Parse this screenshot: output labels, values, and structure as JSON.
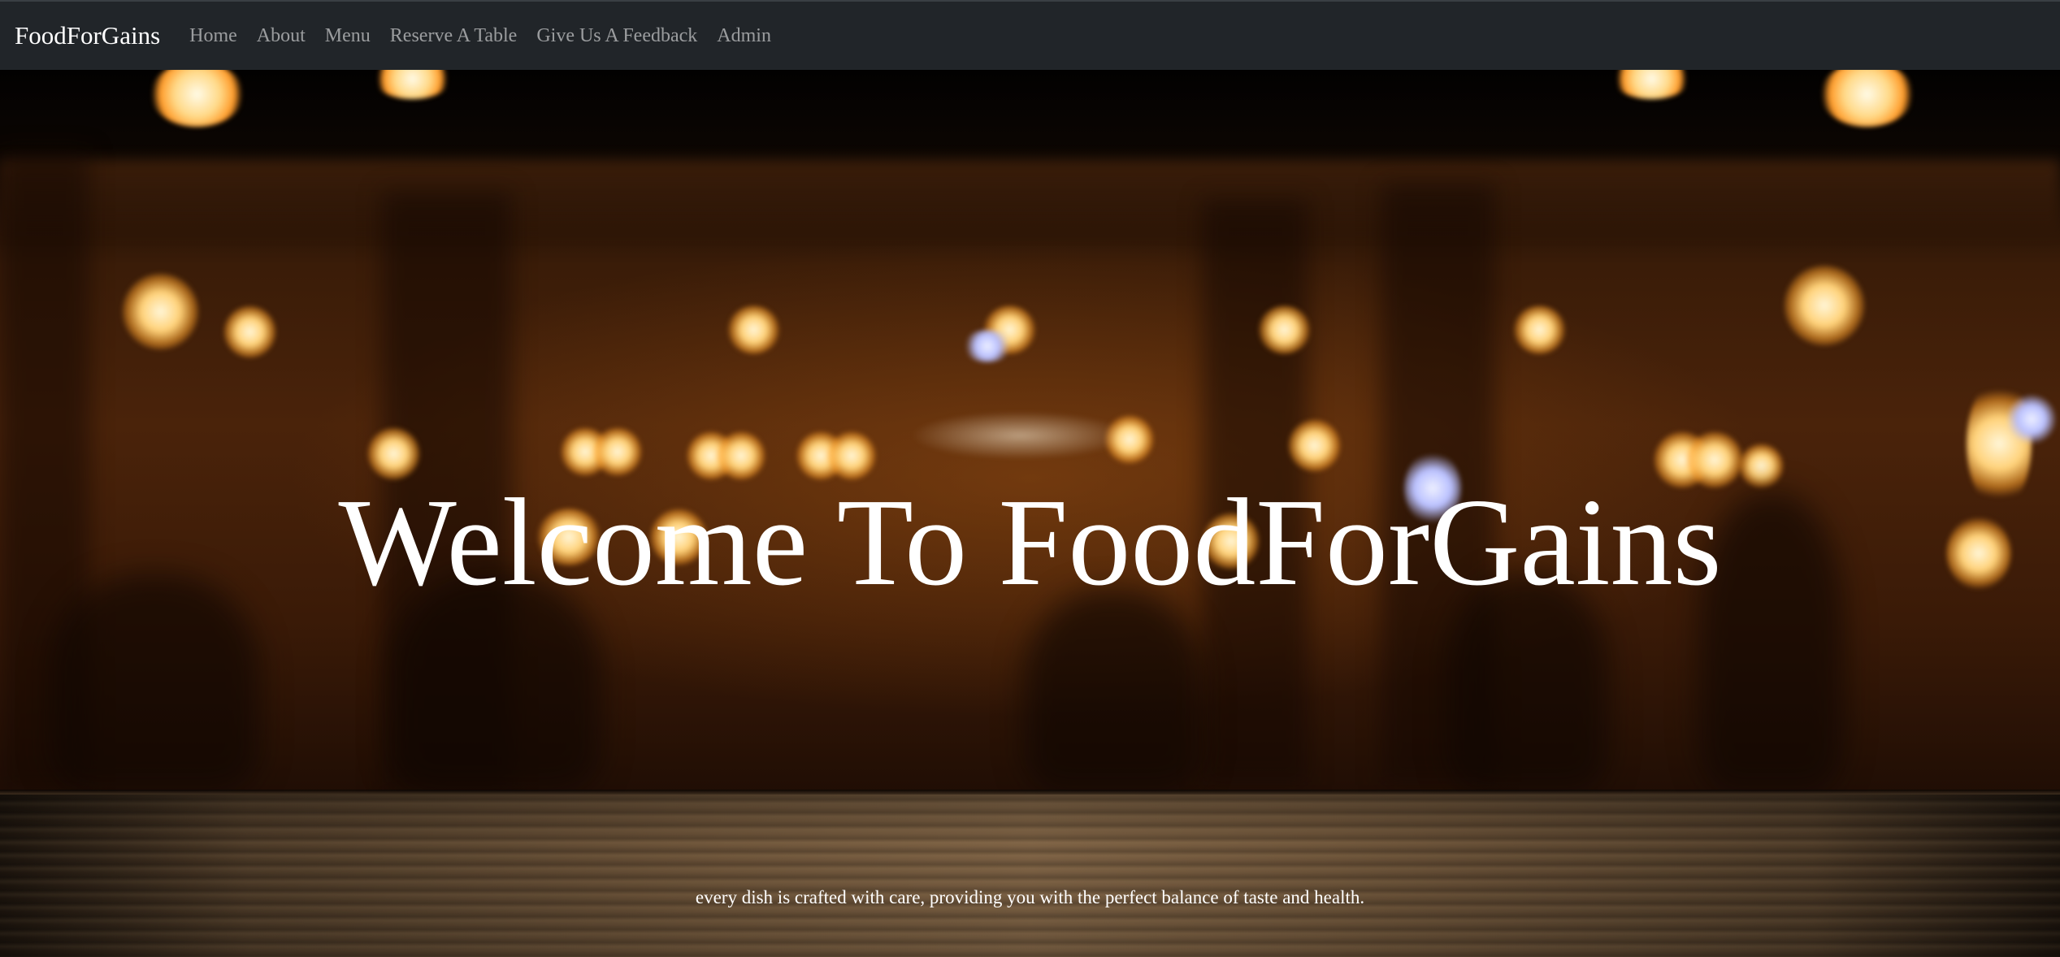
{
  "navbar": {
    "brand": "FoodForGains",
    "links": [
      {
        "label": "Home"
      },
      {
        "label": "About"
      },
      {
        "label": "Menu"
      },
      {
        "label": "Reserve A Table"
      },
      {
        "label": "Give Us A Feedback"
      },
      {
        "label": "Admin"
      }
    ],
    "background_color": "#212529",
    "link_color": "rgba(255,255,255,0.55)"
  },
  "hero": {
    "heading": "Welcome To FoodForGains",
    "tagline": "every dish is crafted with care, providing you with the perfect balance of taste and health.",
    "text_color": "#ffffff"
  }
}
